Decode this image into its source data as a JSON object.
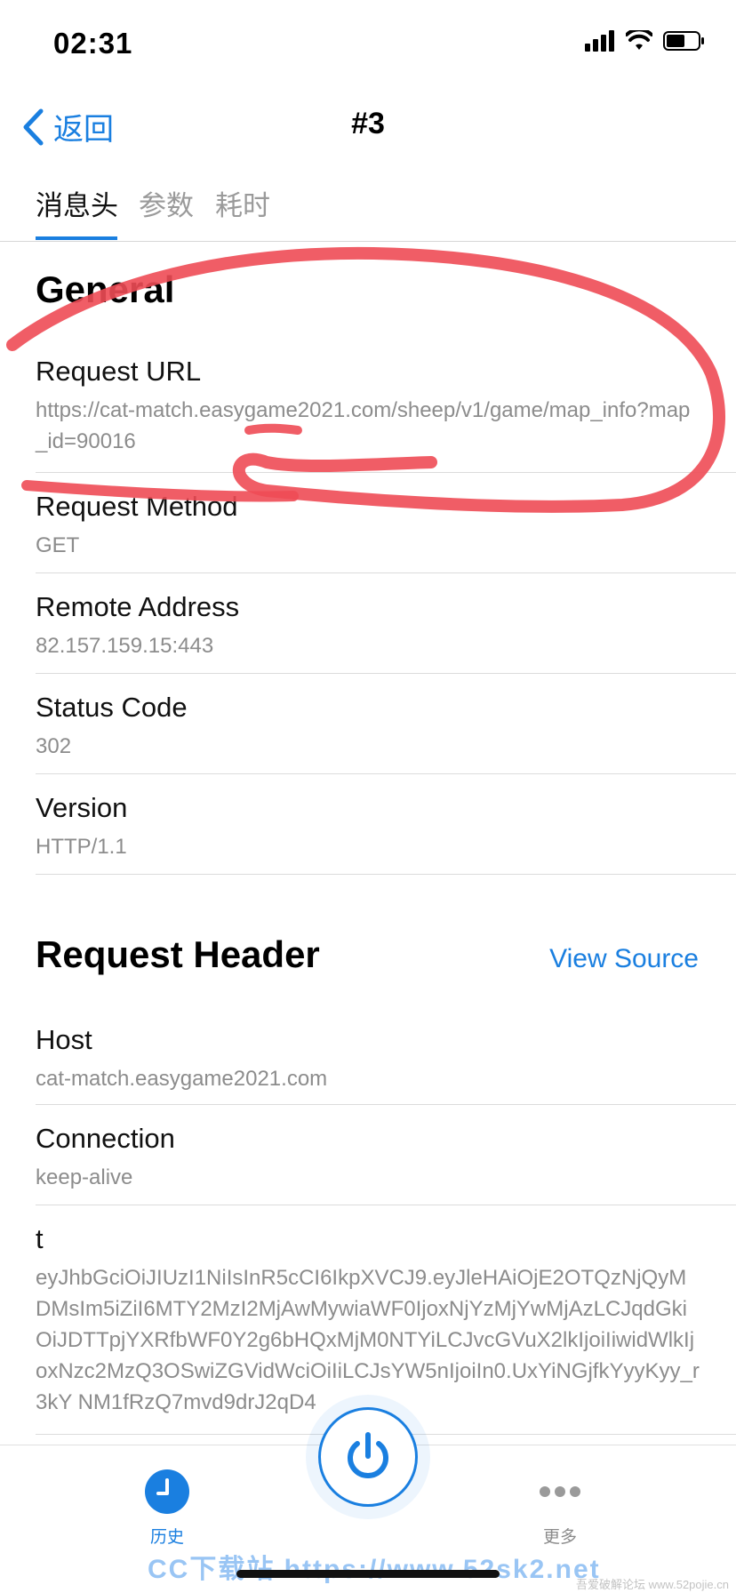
{
  "status_bar": {
    "time": "02:31"
  },
  "nav": {
    "back_label": "返回",
    "title": "#3"
  },
  "tabs": [
    {
      "label": "消息头",
      "active": true
    },
    {
      "label": "参数",
      "active": false
    },
    {
      "label": "耗时",
      "active": false
    }
  ],
  "general": {
    "title": "General",
    "rows": [
      {
        "label": "Request URL",
        "value": "https://cat-match.easygame2021.com/sheep/v1/game/map_info?map_id=90016"
      },
      {
        "label": "Request Method",
        "value": "GET"
      },
      {
        "label": "Remote Address",
        "value": "82.157.159.15:443"
      },
      {
        "label": "Status Code",
        "value": "302"
      },
      {
        "label": "Version",
        "value": "HTTP/1.1"
      }
    ]
  },
  "request_header": {
    "title": "Request Header",
    "view_source_label": "View Source",
    "rows": [
      {
        "label": "Host",
        "value": "cat-match.easygame2021.com"
      },
      {
        "label": "Connection",
        "value": "keep-alive"
      },
      {
        "label": "t",
        "value": "eyJhbGciOiJIUzI1NiIsInR5cCI6IkpXVCJ9.eyJleHAiOjE2OTQzNjQyMDMsIm5iZiI6MTY2MzI2MjAwMywiaWF0IjoxNjYzMjYwMjAzLCJqdGkiOiJDTTpjYXRfbWF0Y2g6bHQxMjM0NTYiLCJvcGVuX2lkIjoiIiwidWlkIjoxNzc2MzQ3OSwiZGVidWciOiIiLCJsYW5nIjoiIn0.UxYiNGjfkYyyKyy_r3kY NM1fRzQ7mvd9drJ2qD4"
      }
    ]
  },
  "tab_bar": {
    "history_label": "历史",
    "more_label": "更多"
  },
  "watermark": {
    "text": "CC下载站 https://www.52sk2.net",
    "right_text": "吾爱破解论坛 www.52pojie.cn"
  },
  "colors": {
    "accent": "#1a7fe0",
    "annotation": "#ee4b55"
  },
  "icons": {
    "back": "chevron-left-icon",
    "history": "clock-icon",
    "power": "power-icon",
    "more": "ellipsis-icon"
  }
}
